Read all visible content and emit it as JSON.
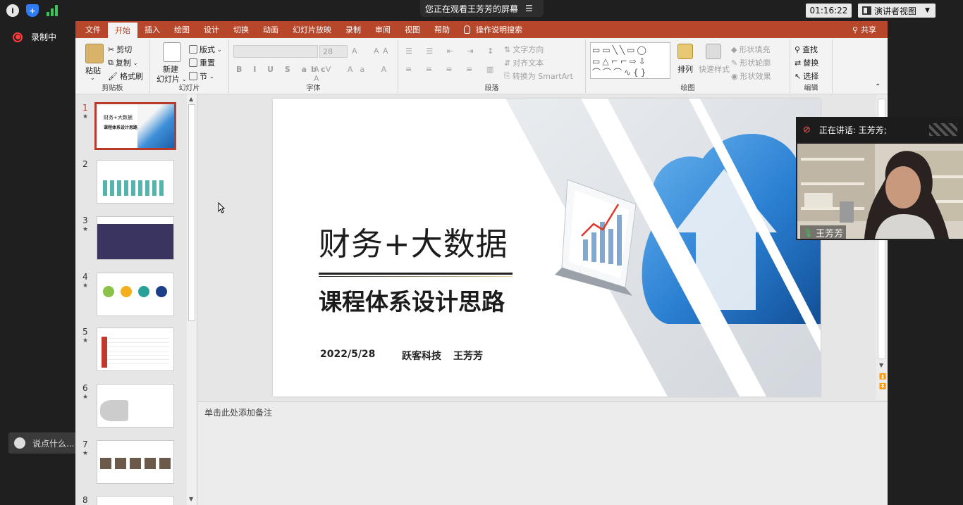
{
  "zoom": {
    "banner_text": "您正在观看王芳芳的屏幕",
    "timer": "01:16:22",
    "view_mode": "演讲者视图",
    "recording_label": "录制中",
    "chat_placeholder": "说点什么...",
    "speaking_label": "正在讲话: 王芳芳;",
    "participant_name": "王芳芳"
  },
  "ppt": {
    "menu": [
      "文件",
      "开始",
      "插入",
      "绘图",
      "设计",
      "切换",
      "动画",
      "幻灯片放映",
      "录制",
      "审阅",
      "视图",
      "帮助"
    ],
    "tell_me": "操作说明搜索",
    "share": "共享",
    "ribbon": {
      "clipboard": {
        "label": "剪贴板",
        "paste": "粘贴",
        "cut": "剪切",
        "copy": "复制",
        "format_painter": "格式刷"
      },
      "slides": {
        "label": "幻灯片",
        "new_slide_1": "新建",
        "new_slide_2": "幻灯片",
        "layout": "版式",
        "reset": "重置",
        "section": "节"
      },
      "font": {
        "label": "字体",
        "size": "28"
      },
      "paragraph": {
        "label": "段落",
        "text_direction": "文字方向",
        "align_text": "对齐文本",
        "smartart": "转换为 SmartArt"
      },
      "drawing": {
        "label": "绘图",
        "arrange": "排列",
        "quick_styles": "快速样式",
        "shape_fill": "形状填充",
        "shape_outline": "形状轮廓",
        "shape_effects": "形状效果"
      },
      "editing": {
        "label": "编辑",
        "find": "查找",
        "replace": "替换",
        "select": "选择"
      }
    },
    "thumbnails": [
      "1",
      "2",
      "3",
      "4",
      "5",
      "6",
      "7",
      "8"
    ],
    "slide": {
      "title": "财务+大数据",
      "subtitle": "课程体系设计思路",
      "date": "2022/5/28",
      "company": "跃客科技",
      "presenter": "王芳芳"
    },
    "thumb1": {
      "title": "财务+大数据",
      "subtitle": "课程体系设计思路"
    },
    "notes_placeholder": "单击此处添加备注"
  }
}
